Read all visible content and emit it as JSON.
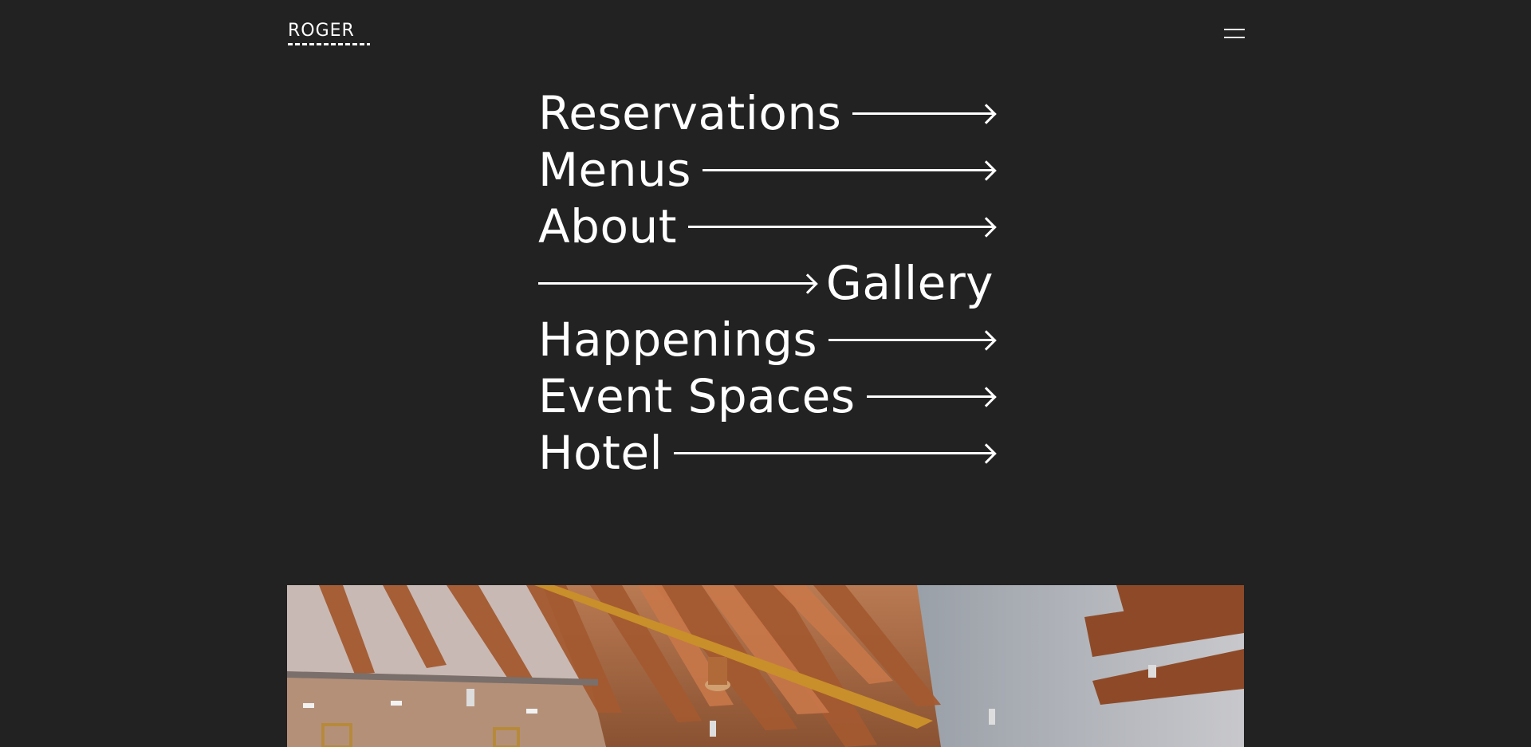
{
  "header": {
    "logo_text": "ROGER"
  },
  "nav": {
    "items": [
      {
        "label": "Reservations"
      },
      {
        "label": "Menus"
      },
      {
        "label": "About"
      },
      {
        "label": "Gallery"
      },
      {
        "label": "Happenings"
      },
      {
        "label": "Event Spaces"
      },
      {
        "label": "Hotel"
      }
    ]
  },
  "colors": {
    "background": "#222222",
    "text": "#ffffff"
  },
  "icons": {
    "menu": "hamburger-menu-icon",
    "arrow": "arrow-right-icon"
  }
}
